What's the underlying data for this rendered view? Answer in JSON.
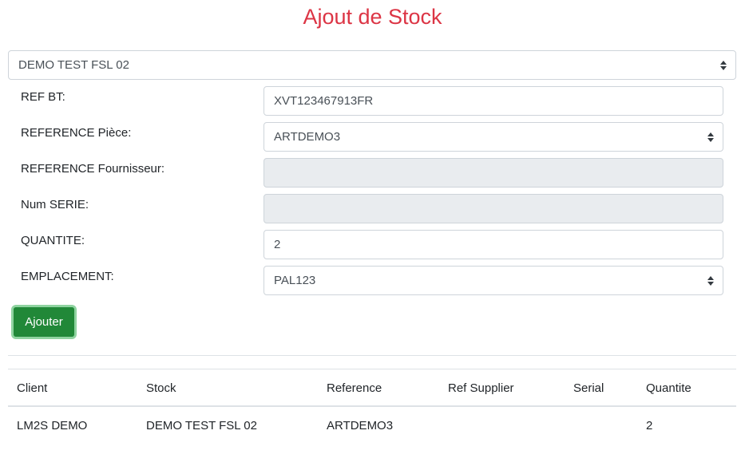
{
  "page": {
    "title": "Ajout de Stock"
  },
  "stock_select": {
    "value": "DEMO TEST FSL 02"
  },
  "form": {
    "ref_bt": {
      "label": "REF BT:",
      "value": "XVT123467913FR"
    },
    "reference_piece": {
      "label": "REFERENCE Pièce:",
      "value": "ARTDEMO3"
    },
    "reference_fournisseur": {
      "label": "REFERENCE Fournisseur:",
      "value": ""
    },
    "num_serie": {
      "label": "Num SERIE:",
      "value": ""
    },
    "quantite": {
      "label": "QUANTITE:",
      "value": "2"
    },
    "emplacement": {
      "label": "EMPLACEMENT:",
      "value": "PAL123"
    },
    "submit_label": "Ajouter"
  },
  "table": {
    "headers": [
      "Client",
      "Stock",
      "Reference",
      "Ref Supplier",
      "Serial",
      "Quantite"
    ],
    "rows": [
      [
        "LM2S DEMO",
        "DEMO TEST FSL 02",
        "ARTDEMO3",
        "",
        "",
        "2"
      ]
    ]
  },
  "colors": {
    "title": "#dc3545",
    "button": "#218838",
    "disabled_field": "#e9ecef"
  }
}
